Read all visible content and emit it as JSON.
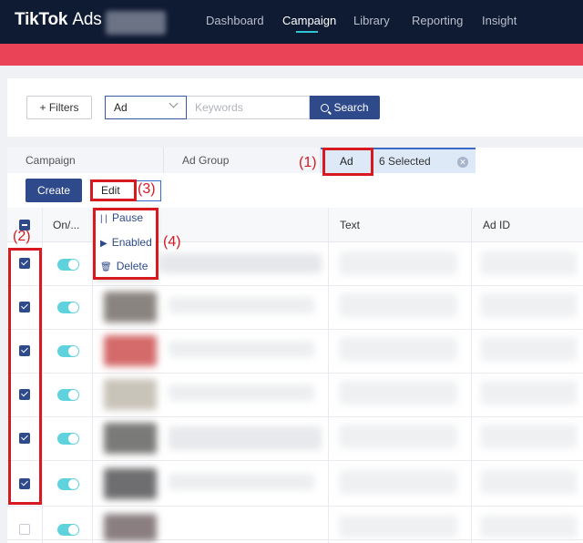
{
  "nav": {
    "brand": "TikTok",
    "brand_suffix": "Ads",
    "items": [
      "Dashboard",
      "Campaign",
      "Library",
      "Reporting",
      "Insight"
    ],
    "active": "Campaign"
  },
  "search": {
    "filters_label": "Filters",
    "level_value": "Ad",
    "keyword_placeholder": "Keywords",
    "search_label": "Search"
  },
  "tabs": {
    "campaign": "Campaign",
    "ad_group": "Ad Group",
    "ad": "Ad",
    "selected_text": "6 Selected"
  },
  "toolbar": {
    "create_label": "Create",
    "edit_label": "Edit"
  },
  "edit_menu": {
    "pause": "Pause",
    "enabled": "Enabled",
    "delete": "Delete"
  },
  "table": {
    "headers": {
      "onoff": "On/...",
      "text": "Text",
      "ad_id": "Ad ID"
    },
    "rows_checked": [
      true,
      true,
      true,
      true,
      true,
      true,
      false
    ]
  },
  "annotations": {
    "a1": "(1)",
    "a2": "(2)",
    "a3": "(3)",
    "a4": "(4)"
  },
  "colors": {
    "nav_bg": "#0f1a33",
    "brand_accent": "#2e4a8a",
    "toggle_on": "#5fd3dd",
    "banner": "#ea4256",
    "annotation_red": "#d71920"
  }
}
